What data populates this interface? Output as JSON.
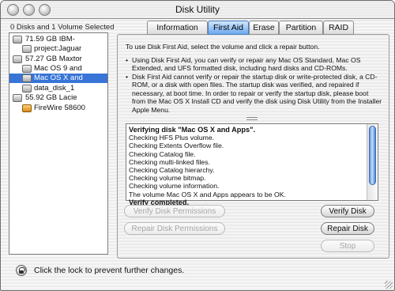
{
  "window": {
    "title": "Disk Utility"
  },
  "selection_info": "0 Disks and 1 Volume Selected",
  "volumes": [
    {
      "label": "71.59 GB IBM-",
      "icon": "hard-disk-icon",
      "level": 0
    },
    {
      "label": "project:Jaguar",
      "icon": "volume-icon",
      "level": 1
    },
    {
      "label": "57.27 GB Maxtor",
      "icon": "hard-disk-icon",
      "level": 0
    },
    {
      "label": "Mac OS 9 and",
      "icon": "volume-icon",
      "level": 1
    },
    {
      "label": "Mac OS X and",
      "icon": "volume-icon",
      "level": 1,
      "selected": true
    },
    {
      "label": "data_disk_1",
      "icon": "volume-icon",
      "level": 1
    },
    {
      "label": "55.92 GB Lacie",
      "icon": "hard-disk-icon",
      "level": 0
    },
    {
      "label": "FireWire 58600",
      "icon": "firewire-disk-icon",
      "level": 1
    }
  ],
  "tabs": [
    {
      "label": "Information"
    },
    {
      "label": "First Aid",
      "active": true
    },
    {
      "label": "Erase"
    },
    {
      "label": "Partition"
    },
    {
      "label": "RAID"
    }
  ],
  "first_aid": {
    "instruction": "To use Disk First Aid, select the volume and click a repair button.",
    "bullets": [
      "Using Disk First Aid, you can verify or repair any Mac OS Standard, Mac OS Extended, and UFS formatted disk, including hard disks and CD-ROMs.",
      "Disk First Aid cannot verify or repair the startup disk or write-protected disk, a CD-ROM, or a disk with open files.  The startup disk was verified, and repaired if necessary, at boot time.  In order to repair or verify the startup disk, please boot from the Mac OS X Install CD and verify the disk using Disk Utility from the Installer Apple Menu."
    ],
    "log": [
      {
        "text": "Verifying disk \"Mac OS X and Apps\".",
        "bold": true
      },
      {
        "text": "Checking HFS Plus volume."
      },
      {
        "text": "Checking Extents Overflow file."
      },
      {
        "text": "Checking Catalog file."
      },
      {
        "text": "Checking multi-linked files."
      },
      {
        "text": "Checking Catalog hierarchy."
      },
      {
        "text": "Checking volume bitmap."
      },
      {
        "text": "Checking volume information."
      },
      {
        "text": "The volume Mac OS X and Apps appears to be OK."
      },
      {
        "text": "Verify completed.",
        "bold": true
      }
    ],
    "buttons": {
      "verify_permissions": "Verify Disk Permissions",
      "repair_permissions": "Repair Disk Permissions",
      "verify_disk": "Verify Disk",
      "repair_disk": "Repair Disk",
      "stop": "Stop"
    }
  },
  "lock_text": "Click the lock to prevent further changes.",
  "colors": {
    "selection": "#3875d7",
    "active_tab": "#6ea9ee"
  }
}
